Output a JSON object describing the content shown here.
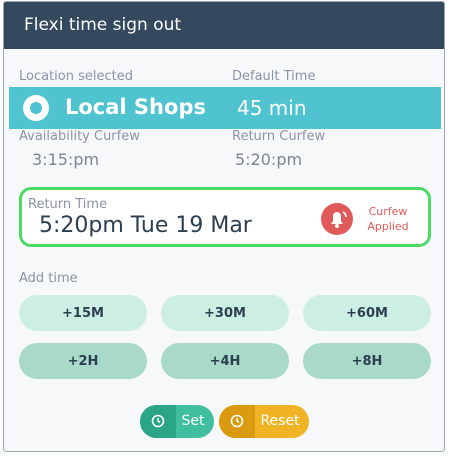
{
  "header": {
    "title": "Flexi time sign out"
  },
  "location": {
    "selected_label": "Location selected",
    "default_time_label": "Default Time",
    "name": "Local Shops",
    "default_time": "45 min"
  },
  "curfew": {
    "availability_label": "Availability Curfew",
    "availability_value": "3:15:pm",
    "return_label": "Return Curfew",
    "return_value": "5:20:pm"
  },
  "return_time": {
    "label": "Return Time",
    "value": "5:20pm Tue 19 Mar",
    "status_line1": "Curfew",
    "status_line2": "Applied"
  },
  "add_time": {
    "label": "Add time",
    "buttons": [
      "+15M",
      "+30M",
      "+60M",
      "+2H",
      "+4H",
      "+8H"
    ]
  },
  "actions": {
    "set": "Set",
    "reset": "Reset"
  },
  "colors": {
    "header": "#34495e",
    "location_bar": "#4fc3cf",
    "return_border": "#4cd964",
    "alert": "#e05a5a",
    "set": "#3fbf9f",
    "reset": "#f0b323"
  }
}
